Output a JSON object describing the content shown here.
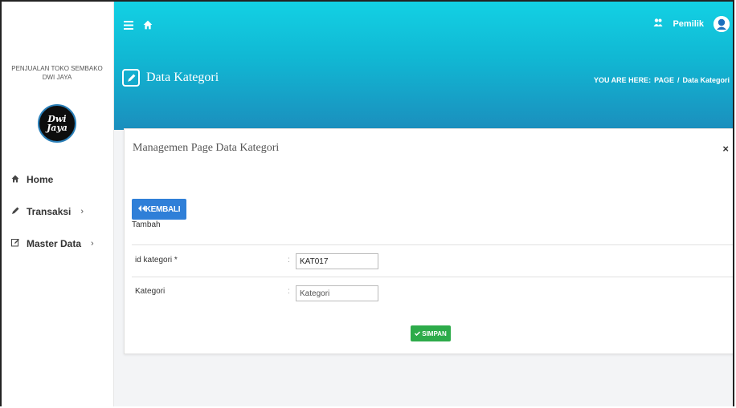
{
  "sidebar": {
    "brand_line1": "PENJUALAN TOKO SEMBAKO",
    "brand_line2": "DWI JAYA",
    "logo_line1": "Dwi",
    "logo_line2": "Jaya",
    "items": [
      {
        "label": "Home",
        "icon": "home-icon"
      },
      {
        "label": "Transaksi",
        "icon": "pencil-icon",
        "chevron": "›"
      },
      {
        "label": "Master Data",
        "icon": "edit-icon",
        "chevron": "›"
      }
    ]
  },
  "header": {
    "user_name": "Pemilik",
    "page_title": "Data Kategori",
    "breadcrumb": {
      "prefix": "YOU ARE HERE:",
      "page": "PAGE",
      "sep": "/",
      "current": "Data Kategori"
    },
    "gradient_colors": [
      "#12d1e4",
      "#1b8ebd"
    ]
  },
  "panel": {
    "title": "Managemen Page Data Kategori",
    "close": "×",
    "back_button": "KEMBALI",
    "section_label": "Tambah",
    "fields": [
      {
        "label": "id kategori *",
        "colon": ":",
        "value": "KAT017",
        "placeholder": ""
      },
      {
        "label": "Kategori",
        "colon": ":",
        "value": "",
        "placeholder": "Kategori"
      }
    ],
    "save_button": "SIMPAN",
    "colors": {
      "back": "#2f7fd8",
      "save": "#2dab4a"
    }
  }
}
